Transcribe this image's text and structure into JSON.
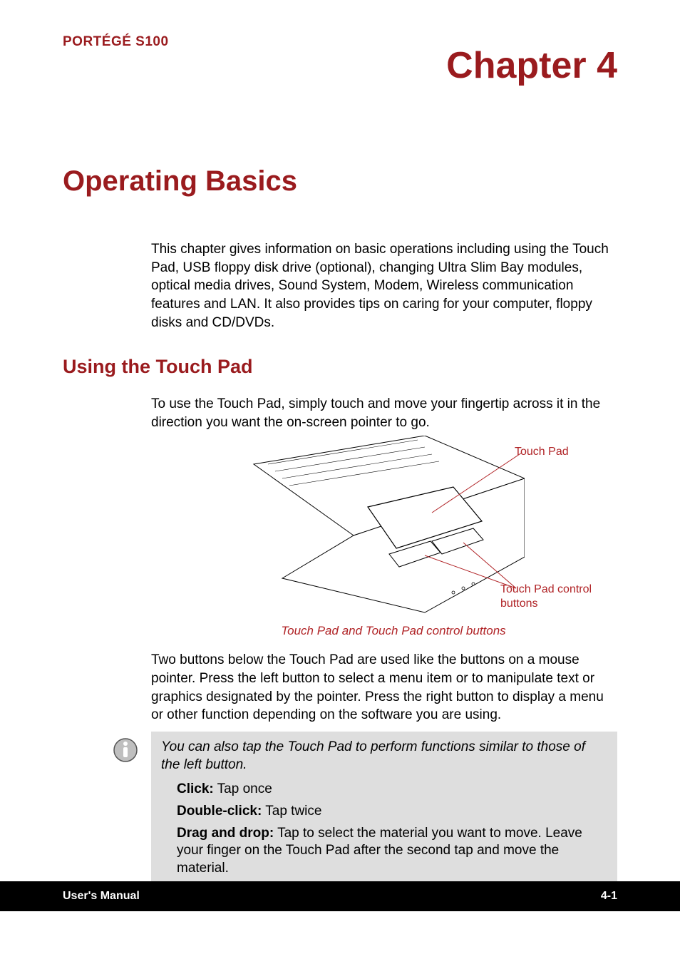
{
  "header": {
    "product": "PORTÉGÉ S100",
    "chapter": "Chapter 4"
  },
  "section": {
    "title": "Operating Basics",
    "intro": "This chapter gives information on basic operations including using the Touch Pad, USB floppy disk drive (optional), changing Ultra Slim Bay modules, optical media drives, Sound System, Modem, Wireless communication features and LAN. It also provides tips on caring for your computer, floppy disks and CD/DVDs."
  },
  "subsection": {
    "title": "Using the Touch Pad",
    "para1": "To use the Touch Pad, simply touch and move your fingertip across it in the direction you want the on-screen pointer to go.",
    "figure": {
      "label_touchpad": "Touch Pad",
      "label_buttons": "Touch Pad control buttons",
      "caption": "Touch Pad and Touch Pad control buttons"
    },
    "para2": "Two buttons below the Touch Pad are used like the buttons on a mouse pointer. Press the left button to select a menu item or to manipulate text or graphics designated by the pointer. Press the right button to display a menu or other function depending on the software you are using."
  },
  "note": {
    "intro": "You can also tap the Touch Pad to perform functions similar to those of the left button.",
    "items": [
      {
        "term": "Click:",
        "desc": " Tap once"
      },
      {
        "term": "Double-click:",
        "desc": " Tap twice"
      },
      {
        "term": "Drag and drop:",
        "desc": " Tap to select the material you want to move. Leave your finger on the Touch Pad after the second tap and move the material."
      }
    ]
  },
  "footer": {
    "left": "User's Manual",
    "right": "4-1"
  },
  "colors": {
    "accent": "#9a1b1e",
    "label_red": "#b02326",
    "note_bg": "#dedede"
  }
}
